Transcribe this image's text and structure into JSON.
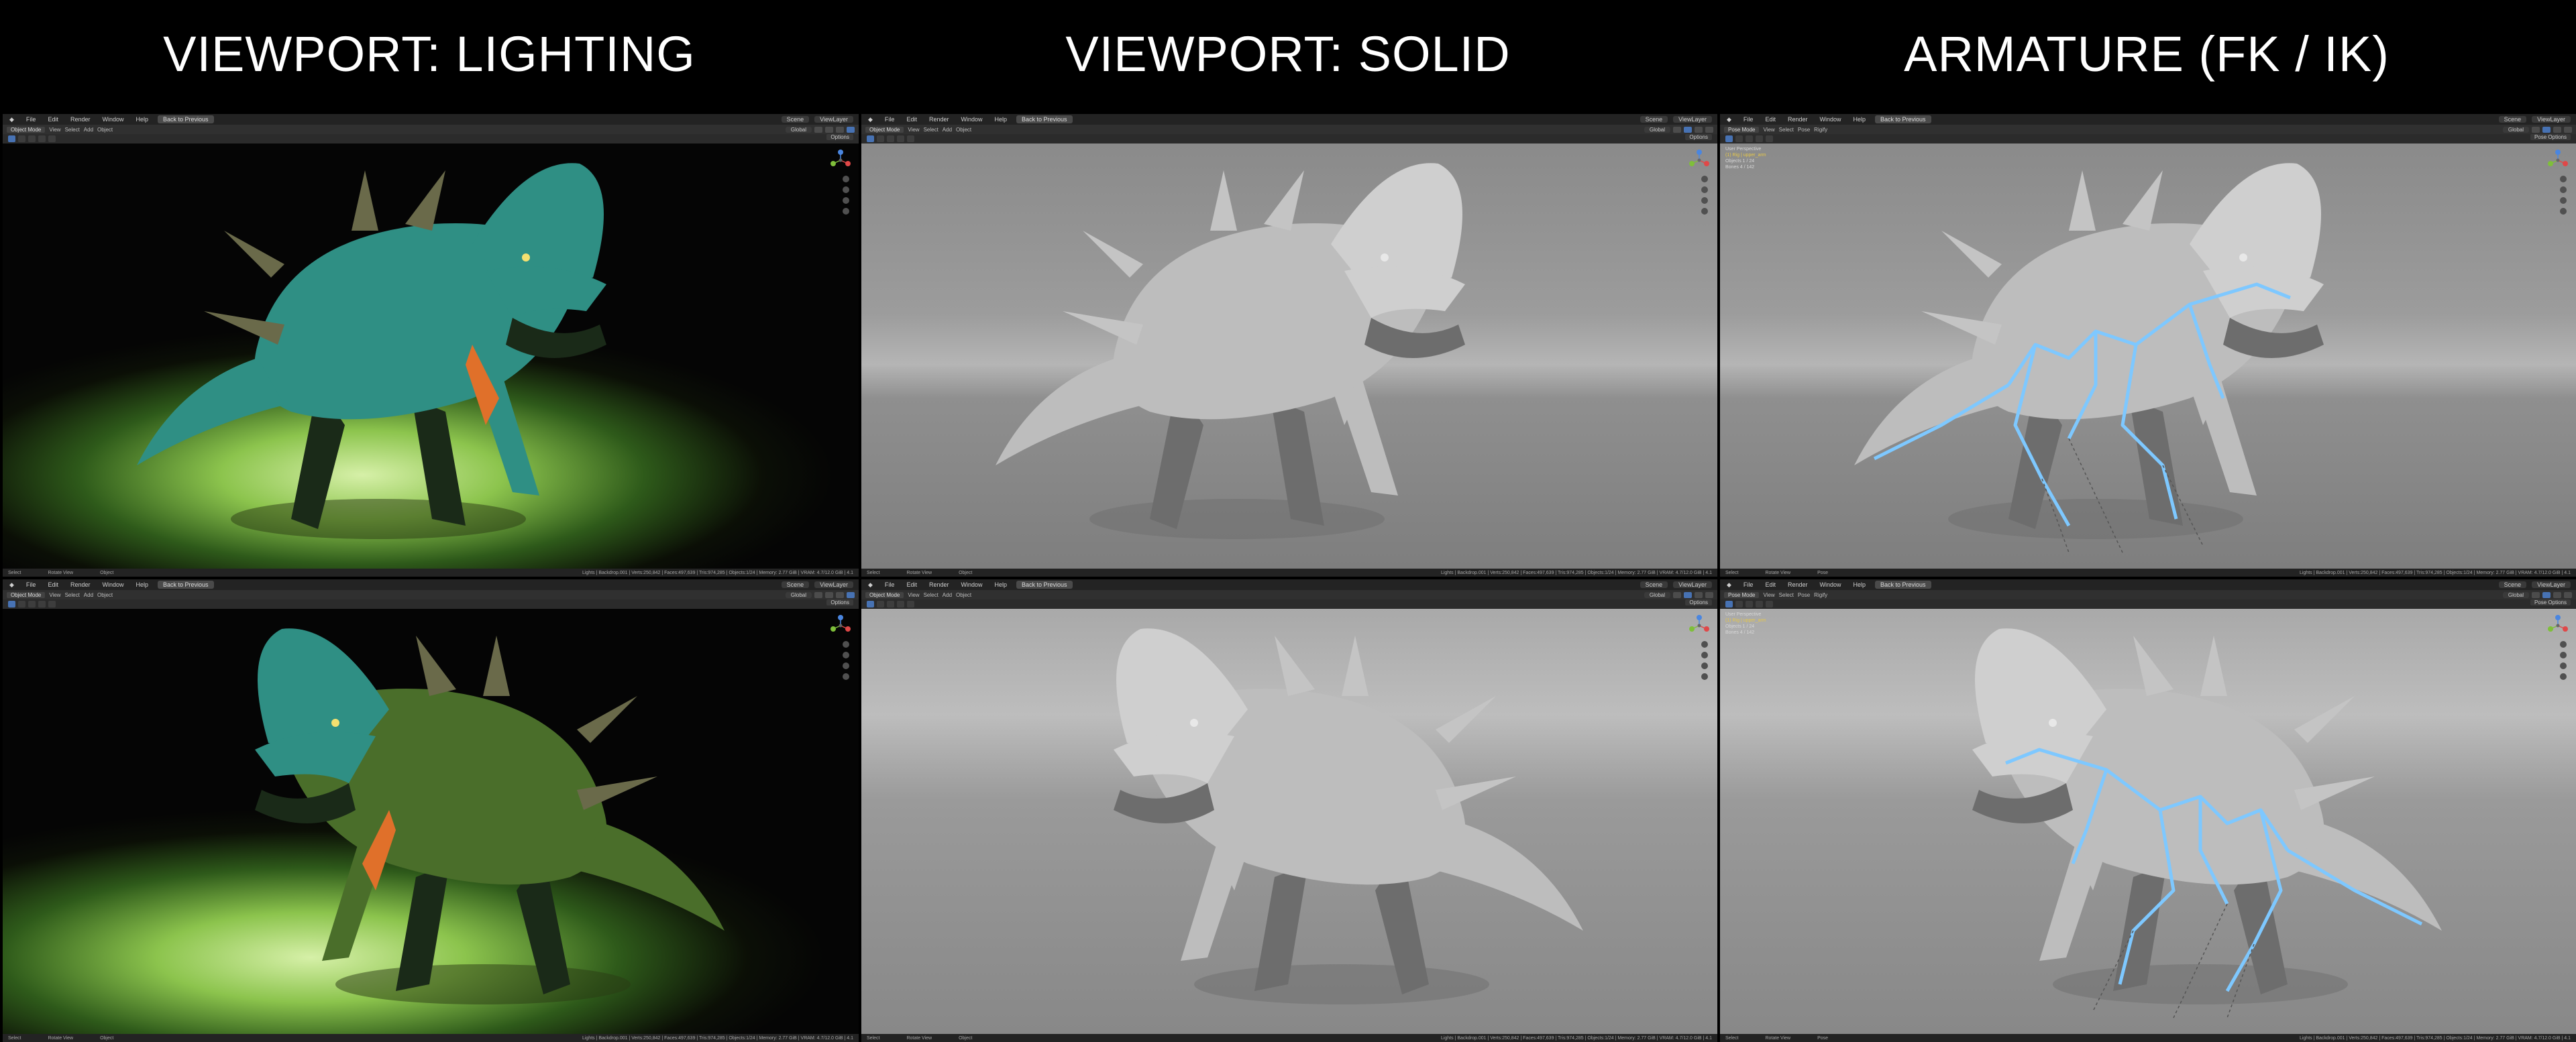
{
  "columns": [
    {
      "title": "VIEWPORT: LIGHTING"
    },
    {
      "title": "VIEWPORT: SOLID"
    },
    {
      "title": "ARMATURE (FK / IK)"
    }
  ],
  "menu": {
    "items": [
      "File",
      "Edit",
      "Render",
      "Window",
      "Help"
    ],
    "back_button": "Back to Previous",
    "scene": "Scene",
    "view_layer": "ViewLayer"
  },
  "header_object": {
    "mode": "Object Mode",
    "items": [
      "View",
      "Select",
      "Add",
      "Object"
    ],
    "transform": "Global",
    "options": "Options"
  },
  "header_pose": {
    "mode": "Pose Mode",
    "items": [
      "View",
      "Select",
      "Pose",
      "Rigify"
    ],
    "transform": "Global",
    "options": "Pose Options"
  },
  "overlay": {
    "view": "User Perspective",
    "object_line": "(1) Rig | upper_arm",
    "objects_label": "Objects",
    "objects_value": "1 / 24",
    "bones_label": "Bones",
    "bones_value": "4 / 142"
  },
  "status": {
    "left": "Select",
    "middle": "Rotate View",
    "right_object": "Object",
    "right_pose": "Pose",
    "stats": "Lights | Backdrop.001 | Verts:250,842 | Faces:497,639 | Tris:974,285 | Objects:1/24 | Memory: 2.77 GiB | VRAM: 4.7/12.0 GiB | 4.1"
  },
  "colors": {
    "bone": "#7ec8ff",
    "creature_teal": "#2f8f84",
    "creature_green": "#4a6e2a",
    "accent_orange": "#e0702a",
    "solid_gray": "#bdbdbd",
    "gizmo_x": "#e04848",
    "gizmo_y": "#7fbf3a",
    "gizmo_z": "#4a86e0"
  },
  "icons": [
    "blender-logo-icon",
    "axis-gizmo-icon",
    "zoom-icon",
    "pan-icon",
    "camera-icon",
    "grid-icon"
  ]
}
